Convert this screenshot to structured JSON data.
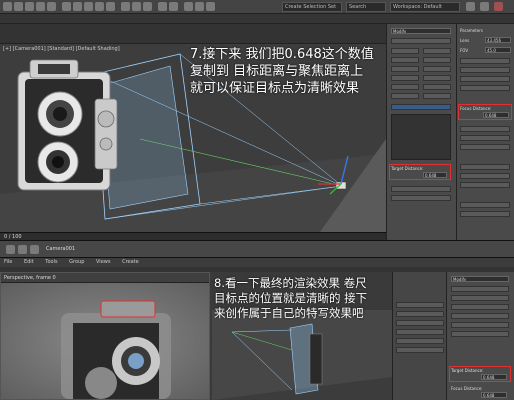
{
  "top": {
    "toolbar_fields": [
      "Create Selection Set",
      "Search",
      "Workspace: Default"
    ],
    "viewport_label": "[+] [Camera001] [Standard] [Default Shading]",
    "caption_lines": [
      "7.接下来 我们把0.648这个数值",
      "复制到 目标距离与聚焦距离上",
      "就可以保证目标点为清晰效果"
    ],
    "cmd_panel_title": "Modify",
    "params_title": "Parameters",
    "lens_label": "Lens",
    "lens_value": "43.456",
    "fov_label": "FOV",
    "fov_value": "45.0",
    "target_distance_label": "Target Distance:",
    "target_distance_value": "0.648",
    "focus_distance_label": "Focus Distance:",
    "focus_distance_value": "0.648",
    "frame_value": "0 / 100"
  },
  "divider": {
    "label": "Camera001"
  },
  "bottom": {
    "menu_items": [
      "File",
      "Edit",
      "Tools",
      "Group",
      "Views",
      "Create"
    ],
    "render_title": "Perspective, frame 0",
    "caption_lines": [
      "8.看一下最终的渲染效果 卷尺",
      "目标点的位置就是清晰的 接下",
      "来创作属于自己的特写效果吧"
    ],
    "cmd_panel_title": "Modify",
    "target_distance_label": "Target Distance:",
    "target_distance_value": "0.648",
    "focus_distance_label": "Focus Distance:",
    "focus_distance_value": "0.648"
  },
  "colors": {
    "highlight": "#e03030",
    "caption": "#ffffff",
    "frustum": "#9fd3ff"
  }
}
